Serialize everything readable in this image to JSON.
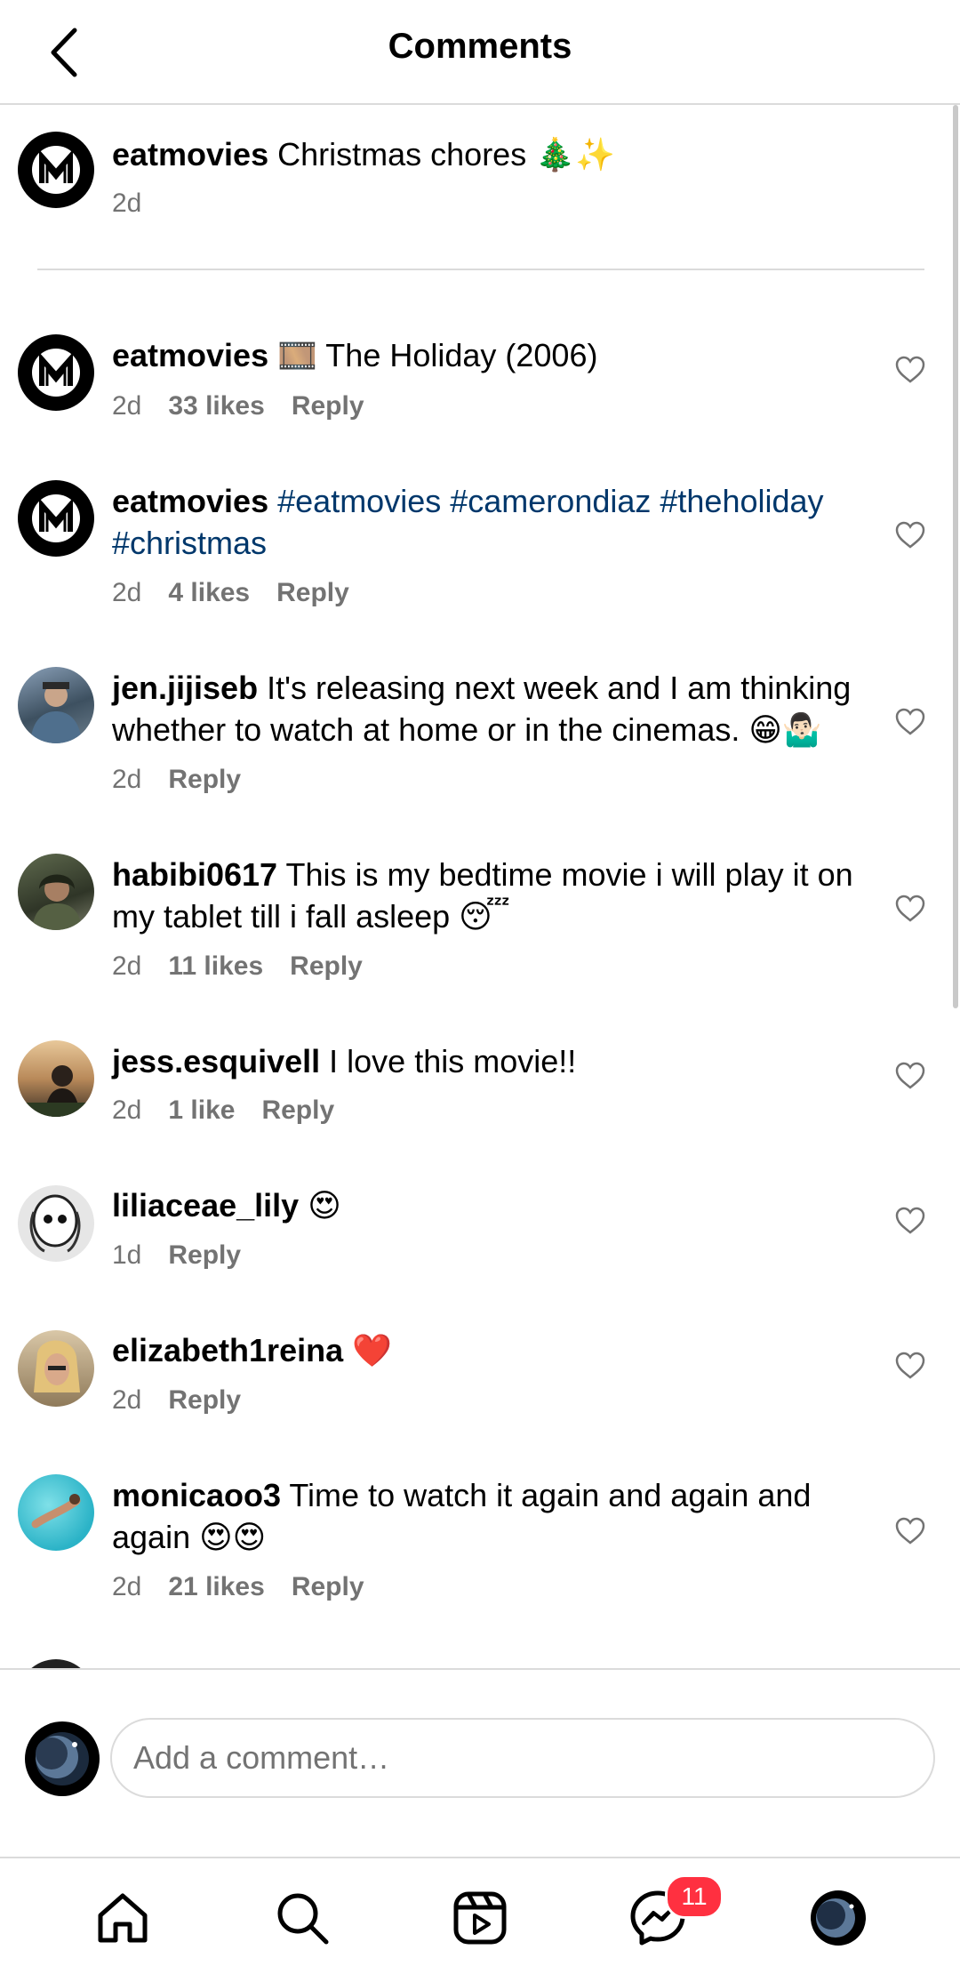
{
  "header": {
    "title": "Comments"
  },
  "caption": {
    "username": "eatmovies",
    "text": "Christmas chores 🎄✨",
    "time": "2d"
  },
  "comments": [
    {
      "username": "eatmovies",
      "text": "🎞️ The Holiday (2006)",
      "time": "2d",
      "likes": "33 likes",
      "reply": "Reply"
    },
    {
      "username": "eatmovies",
      "text": "",
      "tags": [
        "#eatmovies",
        "#camerondiaz",
        "#theholiday",
        "#christmas"
      ],
      "time": "2d",
      "likes": "4 likes",
      "reply": "Reply"
    },
    {
      "username": "jen.jijiseb",
      "text": "It's releasing next week and I am thinking whether to watch at home or in the cinemas. 😁🤷🏻‍♂️",
      "time": "2d",
      "likes": "",
      "reply": "Reply"
    },
    {
      "username": "habibi0617",
      "text": "This is my bedtime movie i will play it on my tablet till i fall asleep 😴",
      "time": "2d",
      "likes": "11 likes",
      "reply": "Reply"
    },
    {
      "username": "jess.esquivell",
      "text": "I love this movie!!",
      "time": "2d",
      "likes": "1 like",
      "reply": "Reply"
    },
    {
      "username": "liliaceae_lily",
      "text": "😍",
      "time": "1d",
      "likes": "",
      "reply": "Reply"
    },
    {
      "username": "elizabeth1reina",
      "text": "❤️",
      "time": "2d",
      "likes": "",
      "reply": "Reply"
    },
    {
      "username": "monicaoo3",
      "text": "Time to watch it again and again and again 😍😍",
      "time": "2d",
      "likes": "21 likes",
      "reply": "Reply"
    }
  ],
  "composer": {
    "placeholder": "Add a comment…"
  },
  "nav": {
    "messages_badge": "11"
  },
  "colors": {
    "hashtag": "#00376b",
    "badge": "#ff3040",
    "meta": "#737373"
  }
}
